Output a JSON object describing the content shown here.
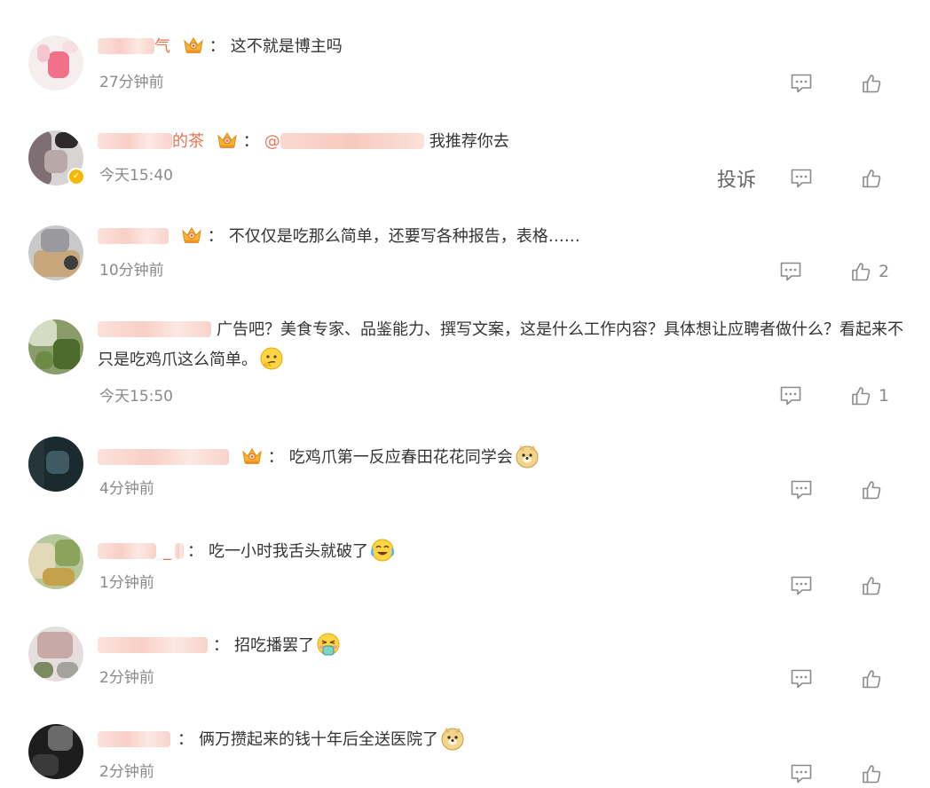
{
  "comments": [
    {
      "name_visible_tail": "气",
      "text": "这不就是博主吗",
      "time": "27分钟前",
      "likes": ""
    },
    {
      "name_visible_tail": "的茶",
      "mention_prefix": "@",
      "text": "我推荐你去",
      "time": "今天15:40",
      "report_label": "投诉",
      "likes": ""
    },
    {
      "name_visible_tail": "",
      "text": "不仅仅是吃那么简单，还要写各种报告，表格……",
      "time": "10分钟前",
      "likes": "2"
    },
    {
      "name_visible_tail": "",
      "text": "广告吧？美食专家、品鉴能力、撰写文案，这是什么工作内容？具体想让应聘者做什么？看起来不只是吃鸡爪这么简单。",
      "time": "今天15:50",
      "likes": "1"
    },
    {
      "name_visible_tail": "",
      "text": "吃鸡爪第一反应春田花花同学会",
      "time": "4分钟前",
      "likes": ""
    },
    {
      "name_visible_tail": "_",
      "text": "吃一小时我舌头就破了",
      "time": "1分钟前",
      "likes": ""
    },
    {
      "name_visible_tail": "",
      "text": "招吃播罢了",
      "time": "2分钟前",
      "likes": ""
    },
    {
      "name_visible_tail": "",
      "text": "俩万攒起来的钱十年后全送医院了",
      "time": "2分钟前",
      "likes": ""
    }
  ],
  "colon": "：",
  "icons": {
    "comment": "reply-comment-icon",
    "like": "thumbs-up-icon",
    "crown": "member-crown-icon",
    "verified": "verified-badge-icon"
  },
  "colors": {
    "username": "#eb7350",
    "time": "#8a8a8a",
    "text": "#333333"
  }
}
